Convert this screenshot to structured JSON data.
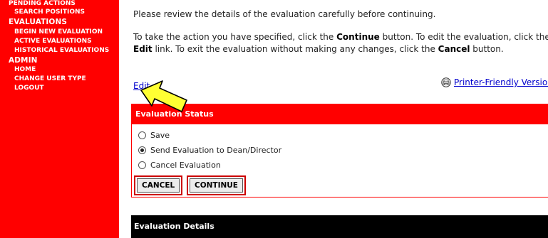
{
  "sidebar": {
    "items_top": [
      "PENDING ACTIONS",
      "SEARCH POSITIONS"
    ],
    "evaluations_header": "EVALUATIONS",
    "evaluations_items": [
      "BEGIN NEW EVALUATION",
      "ACTIVE EVALUATIONS",
      "HISTORICAL EVALUATIONS"
    ],
    "admin_header": "ADMIN",
    "admin_items": [
      "HOME",
      "CHANGE USER TYPE",
      "LOGOUT"
    ]
  },
  "main": {
    "intro": "Please review the details of the evaluation carefully before continuing.",
    "para": {
      "t1": "To take the action you have specified, click the ",
      "continue_word": "Continue",
      "t2": " button. To edit the evaluation, click the ",
      "edit_word": "Edit",
      "t3": " link. To exit the evaluation without making any changes, click the ",
      "cancel_word": "Cancel",
      "t4": " button."
    },
    "edit_link": "Edit",
    "printer_link": "Printer-Friendly Version"
  },
  "status": {
    "header": "Evaluation Status",
    "options": [
      "Save",
      "Send Evaluation to Dean/Director",
      "Cancel Evaluation"
    ],
    "selected": "Send Evaluation to Dean/Director",
    "cancel_button": "CANCEL",
    "continue_button": "CONTINUE"
  },
  "details": {
    "header": "Evaluation Details"
  },
  "colors": {
    "accent": "#ff0000",
    "highlight_arrow": "#ffff33",
    "link": "#0000cc"
  },
  "icons": {
    "printer": "printer-icon",
    "pointer": "arrow-pointer-icon"
  }
}
